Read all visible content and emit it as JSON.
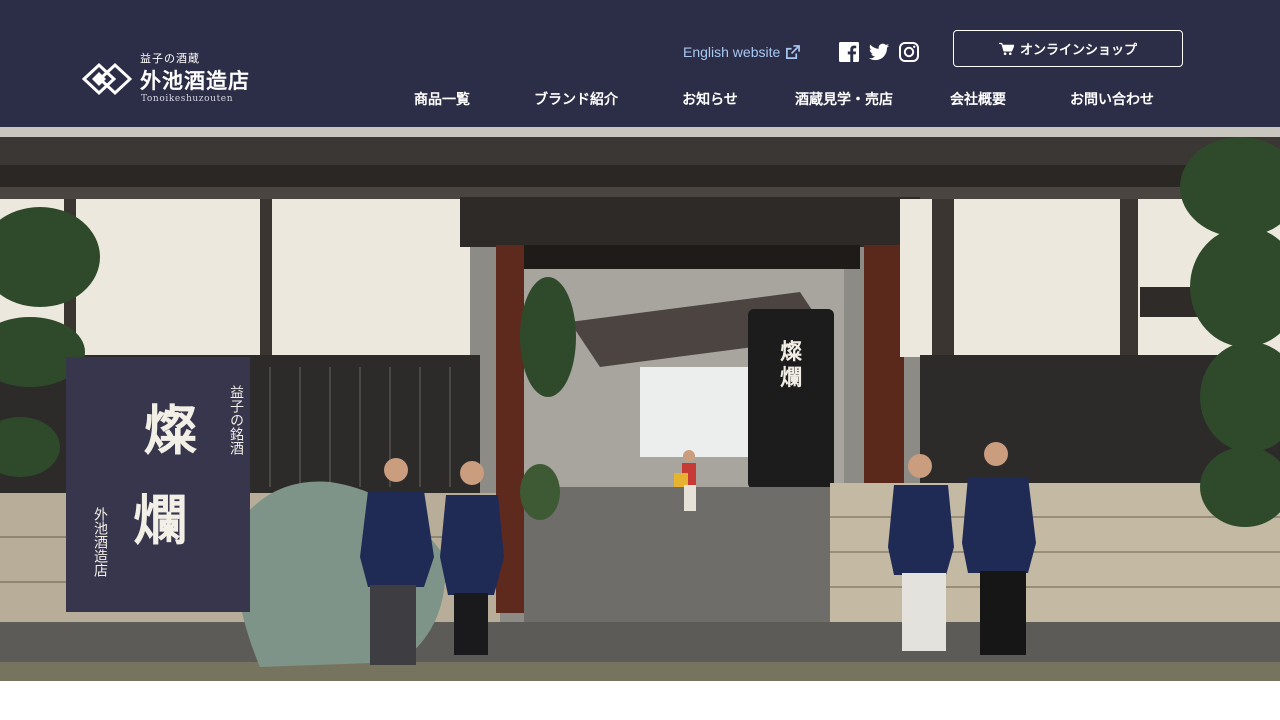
{
  "brand": {
    "tagline": "益子の酒蔵",
    "name": "外池酒造店",
    "romaji": "Tonoikeshuzouten"
  },
  "header": {
    "english_link": "English website",
    "online_shop": "オンラインショップ",
    "social": [
      "facebook-icon",
      "twitter-icon",
      "instagram-icon"
    ]
  },
  "nav": {
    "items": [
      {
        "label": "商品一覧"
      },
      {
        "label": "ブランド紹介"
      },
      {
        "label": "お知らせ"
      },
      {
        "label": "酒蔵見学・売店"
      },
      {
        "label": "会社概要"
      },
      {
        "label": "お問い合わせ"
      }
    ]
  },
  "hero": {
    "banner": {
      "subtitle": "益子の銘酒",
      "brand_char_1": "燦",
      "brand_char_2": "爛",
      "maker": "外池酒造店"
    },
    "tank_label_1": "燦",
    "tank_label_2": "爛"
  },
  "colors": {
    "header_bg": "#2c2d46",
    "link": "#a8c8f2",
    "text_on_dark": "#ffffff"
  }
}
